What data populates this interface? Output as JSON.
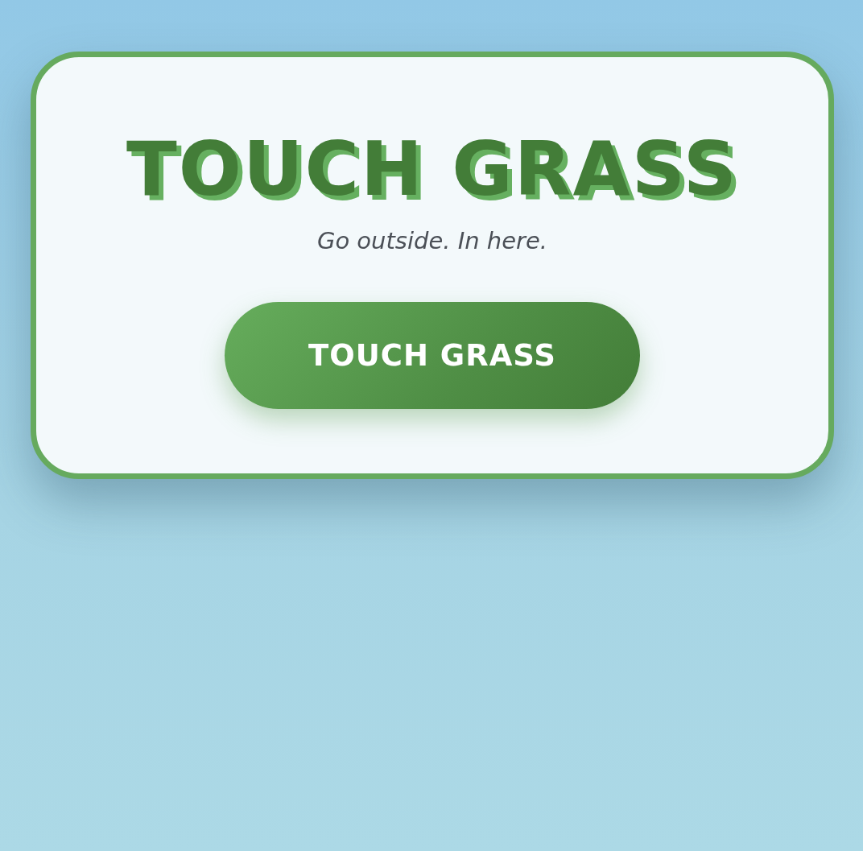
{
  "card": {
    "title": "TOUCH GRASS",
    "subtitle": "Go outside. In here.",
    "button": {
      "label": "TOUCH GRASS"
    }
  }
}
